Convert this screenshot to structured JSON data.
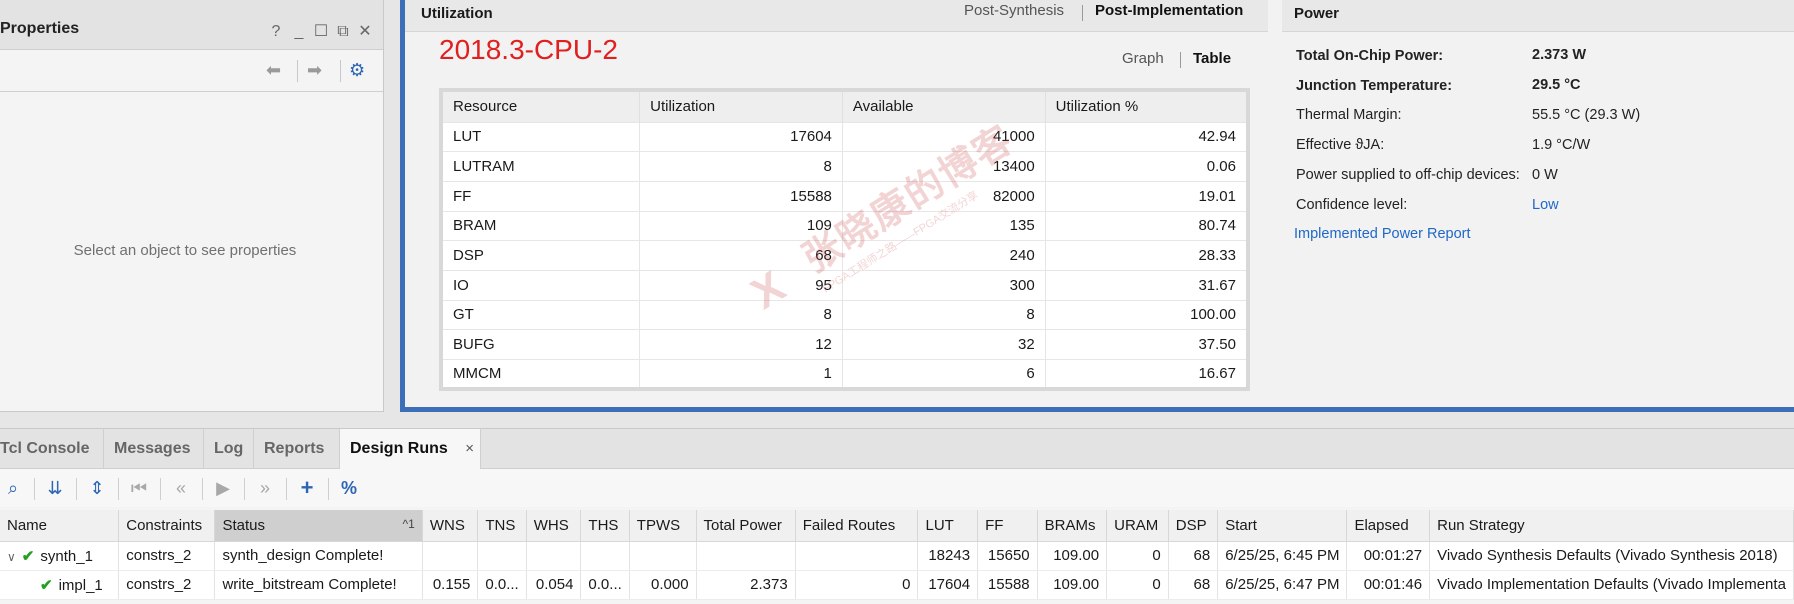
{
  "properties": {
    "title": "Properties",
    "help_glyph": "?",
    "minimize_glyph": "_",
    "maximize_glyph": "☐",
    "float_glyph": "⧉",
    "close_glyph": "✕",
    "back_glyph": "⬅",
    "forward_glyph": "➡",
    "settings_glyph": "⚙",
    "empty_message": "Select an object to see properties"
  },
  "utilization": {
    "title": "Utilization",
    "views": {
      "post_synthesis": "Post-Synthesis",
      "post_implementation": "Post-Implementation"
    },
    "overlay_title": "2018.3-CPU-2",
    "display_modes": {
      "graph": "Graph",
      "table": "Table"
    },
    "columns": [
      "Resource",
      "Utilization",
      "Available",
      "Utilization %"
    ],
    "rows": [
      [
        "LUT",
        "17604",
        "41000",
        "42.94"
      ],
      [
        "LUTRAM",
        "8",
        "13400",
        "0.06"
      ],
      [
        "FF",
        "15588",
        "82000",
        "19.01"
      ],
      [
        "BRAM",
        "109",
        "135",
        "80.74"
      ],
      [
        "DSP",
        "68",
        "240",
        "28.33"
      ],
      [
        "IO",
        "95",
        "300",
        "31.67"
      ],
      [
        "GT",
        "8",
        "8",
        "100.00"
      ],
      [
        "BUFG",
        "12",
        "32",
        "37.50"
      ],
      [
        "MMCM",
        "1",
        "6",
        "16.67"
      ]
    ],
    "watermark": {
      "main": "张晓康的博客",
      "sub": "FPGA工程师之路——FPGA交流分享",
      "logo": "X"
    }
  },
  "power": {
    "title": "Power",
    "items": [
      {
        "label": "Total On-Chip Power:",
        "value": "2.373 W"
      },
      {
        "label": "Junction Temperature:",
        "value": "29.5 °C"
      },
      {
        "label": "Thermal Margin:",
        "value": "55.5 °C (29.3 W)"
      },
      {
        "label": "Effective ϑJA:",
        "value": "1.9 °C/W"
      },
      {
        "label": "Power supplied to off-chip devices:",
        "value": "0 W"
      },
      {
        "label": "Confidence level:",
        "value": "Low"
      }
    ],
    "report_link": "Implemented Power Report"
  },
  "bottom": {
    "tabs": [
      "Tcl Console",
      "Messages",
      "Log",
      "Reports",
      "Design Runs"
    ],
    "active_tab": "Design Runs",
    "close_glyph": "×",
    "toolbar": {
      "search": "⌕",
      "collapse": "⇊",
      "expand": "⇕",
      "first": "⏮",
      "prev": "«",
      "play": "▶",
      "next": "»",
      "add": "+",
      "percent": "%"
    },
    "sort_indicator": "^1",
    "columns": [
      "Name",
      "Constraints",
      "Status",
      "WNS",
      "TNS",
      "WHS",
      "THS",
      "TPWS",
      "Total Power",
      "Failed Routes",
      "LUT",
      "FF",
      "BRAMs",
      "URAM",
      "DSP",
      "Start",
      "Elapsed",
      "Run Strategy"
    ],
    "runs": [
      {
        "caret": "∨",
        "check": "✔",
        "name": "synth_1",
        "constraints": "constrs_2",
        "status": "synth_design Complete!",
        "wns": "",
        "tns": "",
        "whs": "",
        "ths": "",
        "tpws": "",
        "total_power": "",
        "failed_routes": "",
        "lut": "18243",
        "ff": "15650",
        "brams": "109.00",
        "uram": "0",
        "dsp": "68",
        "start": "6/25/25, 6:45 PM",
        "elapsed": "00:01:27",
        "strategy": "Vivado Synthesis Defaults (Vivado Synthesis 2018)"
      },
      {
        "caret": "",
        "check": "✔",
        "name": "impl_1",
        "constraints": "constrs_2",
        "status": "write_bitstream Complete!",
        "wns": "0.155",
        "tns": "0.0...",
        "whs": "0.054",
        "ths": "0.0...",
        "tpws": "0.000",
        "total_power": "2.373",
        "failed_routes": "0",
        "lut": "17604",
        "ff": "15588",
        "brams": "109.00",
        "uram": "0",
        "dsp": "68",
        "start": "6/25/25, 6:47 PM",
        "elapsed": "00:01:46",
        "strategy": "Vivado Implementation Defaults (Vivado Implementa"
      }
    ]
  },
  "colors": {
    "accent_blue": "#3c6fb7",
    "overlay_red": "#e0201f",
    "link_blue": "#1f67c8",
    "check_green": "#22a022"
  }
}
